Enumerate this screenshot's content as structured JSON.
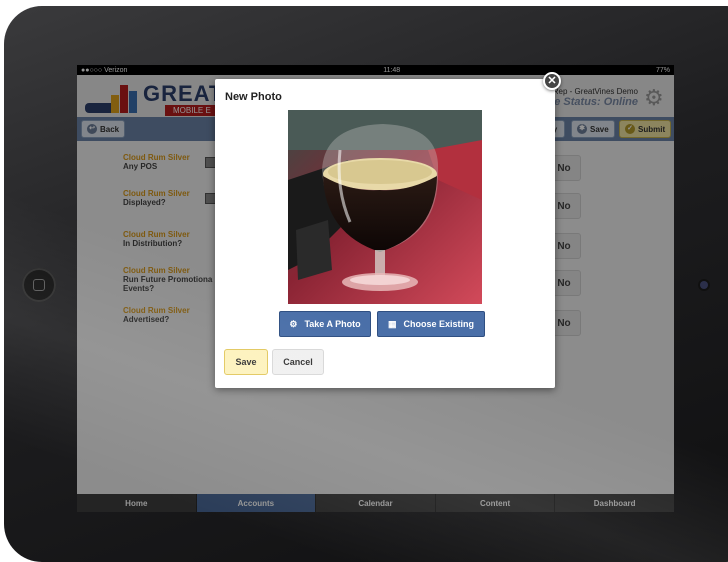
{
  "status_bar": {
    "carrier": "●●○○○ Verizon",
    "wifi_icon": "wifi-icon",
    "time": "11:48",
    "battery": "77%"
  },
  "app_header": {
    "logo_text": "GREAT",
    "logo_sub": "MOBILE E",
    "rep": "Rep - GreatVines Demo",
    "status": "bile Status: Online"
  },
  "toolbar": {
    "back_label": "Back",
    "partial_label": "y",
    "save_label": "Save",
    "submit_label": "Submit"
  },
  "questions": [
    {
      "title": "Cloud Rum Silver",
      "subtitle": "Any POS",
      "answer": "No"
    },
    {
      "title": "Cloud Rum Silver",
      "subtitle": "Displayed?",
      "answer": "No"
    },
    {
      "title": "Cloud Rum Silver",
      "subtitle": "In Distribution?",
      "answer": "No"
    },
    {
      "title": "Cloud Rum Silver",
      "subtitle": "Run Future Promotiona",
      "subtitle2": "Events?",
      "answer": "No"
    },
    {
      "title": "Cloud Rum Silver",
      "subtitle": "Advertised?",
      "answer": "No"
    }
  ],
  "tabs": [
    {
      "label": "Home",
      "active": false
    },
    {
      "label": "Accounts",
      "active": true
    },
    {
      "label": "Calendar",
      "active": false
    },
    {
      "label": "Content",
      "active": false
    },
    {
      "label": "Dashboard",
      "active": false
    }
  ],
  "modal": {
    "title": "New Photo",
    "take_photo_label": "Take A Photo",
    "choose_existing_label": "Choose Existing",
    "save_label": "Save",
    "cancel_label": "Cancel"
  },
  "colors": {
    "accent": "#4a6fa8",
    "question_title": "#d99a1a",
    "save_yellow": "#fdf2bd"
  }
}
